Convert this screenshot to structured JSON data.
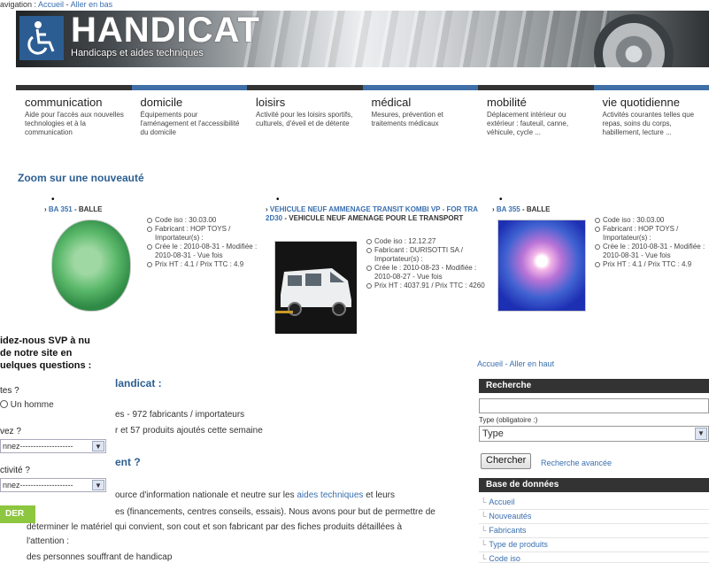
{
  "topnav": {
    "prefix": "avigation : ",
    "home": "Accueil",
    "sep": " - ",
    "down": "Aller en bas"
  },
  "banner": {
    "title": "HANDICAT",
    "subtitle": "Handicaps et aides techniques"
  },
  "categories": [
    {
      "title": "communication",
      "desc": "Aide pour l'accès aux nouvelles technologies et à la communication"
    },
    {
      "title": "domicile",
      "desc": "Équipements pour l'aménagement et l'accessibilité du domicile"
    },
    {
      "title": "loisirs",
      "desc": "Activité pour les loisirs sportifs, culturels, d'éveil et de détente"
    },
    {
      "title": "médical",
      "desc": "Mesures, prévention et traitements médicaux"
    },
    {
      "title": "mobilité",
      "desc": "Déplacement intérieur ou extérieur : fauteuil, canne, véhicule, cycle ..."
    },
    {
      "title": "vie quotidienne",
      "desc": "Activités courantes telles que repas, soins du corps, habillement, lecture ..."
    }
  ],
  "zoom": {
    "title": "Zoom sur une nouveauté"
  },
  "products": [
    {
      "link": "BA 351",
      "name": " - BALLE",
      "info": [
        "Code iso : 30.03.00",
        "Fabricant : HOP TOYS / Importateur(s) :",
        "Crée le : 2010-08-31 - Modifiée : 2010-08-31 - Vue fois",
        "Prix HT : 4.1 / Prix TTC : 4.9"
      ]
    },
    {
      "link": "VEHICULE NEUF AMMENAGE TRANSIT KOMBI VP - FOR TRA 2D30",
      "name": " - VEHICULE NEUF AMENAGE POUR LE TRANSPORT",
      "info": [
        "Code iso : 12.12.27",
        "Fabricant : DURISOTTI SA / Importateur(s) :",
        "Crée le : 2010-08-23 - Modifiée : 2010-08-27 - Vue fois",
        "Prix HT : 4037.91 / Prix TTC : 4260"
      ]
    },
    {
      "link": "BA 355",
      "name": " - BALLE",
      "info": [
        "Code iso : 30.03.00",
        "Fabricant : HOP TOYS / Importateur(s) :",
        "Crée le : 2010-08-31 - Modifiée : 2010-08-31 - Vue fois",
        "Prix HT : 4.1 / Prix TTC : 4.9"
      ]
    }
  ],
  "survey": {
    "heading": "idez-nous SVP à nu de notre site en uelques questions :",
    "q1": "tes ?",
    "q1_option": "Un homme",
    "q2": "vez ?",
    "q2_select": "nnez--------------------",
    "q3": "ctivité ?",
    "q3_select": "nnez--------------------",
    "submit": "DER"
  },
  "main": {
    "h1": "landicat :",
    "stats1": "es - 972 fabricants / importateurs",
    "stats2": "r et 57 produits ajoutés cette semaine",
    "h2": "ent ?",
    "p1_a": "ource d'information nationale et neutre sur les ",
    "p1_link": "aides techniques",
    "p1_b": " et leurs",
    "p2": "es (financements, centres conseils, essais). Nous avons pour but de permettre de",
    "p3": "déterminer le matériel qui convient, son cout et son fabricant par des fiches produits détaillées à",
    "p4": "l'attention :",
    "p5": "des personnes souffrant de handicap"
  },
  "right": {
    "top_home": "Accueil",
    "top_sep": " - ",
    "top_up": "Aller en haut",
    "search_head": "Recherche",
    "type_label": "Type (obligatoire :)",
    "type_value": "Type",
    "search_btn": "Chercher",
    "advanced": "Recherche avancée",
    "db_head": "Base de données",
    "db_items": [
      "Accueil",
      "Nouveautés",
      "Fabricants",
      "Type de produits",
      "Code iso"
    ]
  }
}
